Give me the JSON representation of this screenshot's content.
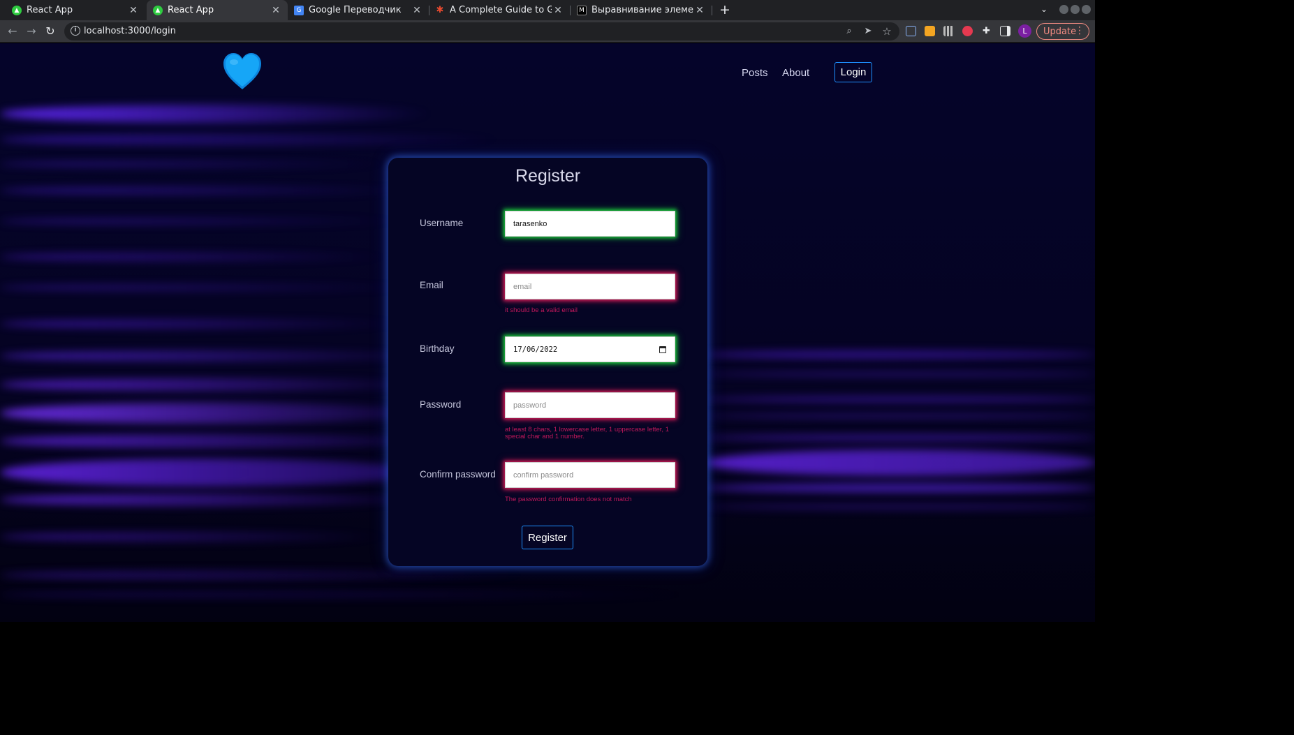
{
  "browser": {
    "tabs": [
      {
        "title": "React App",
        "favicon_color": "#2ecc40",
        "active": false
      },
      {
        "title": "React App",
        "favicon_color": "#2ecc40",
        "active": true
      },
      {
        "title": "Google Переводчик",
        "favicon_color": "#4285f4",
        "active": false
      },
      {
        "title": "A Complete Guide to Grid",
        "favicon_color": "#e84a2f",
        "active": false
      },
      {
        "title": "Выравнивание элементов",
        "favicon_color": "#000000",
        "active": false
      }
    ],
    "favicon_letters": {
      "google_translate": "G",
      "medium": "M"
    },
    "close_glyph": "✕",
    "new_tab": "+",
    "url": "localhost:3000/login",
    "update_label": "Update",
    "profile_initial": "L"
  },
  "header": {
    "logo": "blue-heart",
    "nav": {
      "posts": "Posts",
      "about": "About",
      "login": "Login"
    }
  },
  "form": {
    "title": "Register",
    "fields": {
      "username": {
        "label": "Username",
        "value": "tarasenko",
        "placeholder": "",
        "state": "valid"
      },
      "email": {
        "label": "Email",
        "value": "",
        "placeholder": "email",
        "state": "invalid",
        "error": "it should be a valid email"
      },
      "birthday": {
        "label": "Birthday",
        "value": "17/06/2022",
        "state": "valid"
      },
      "password": {
        "label": "Password",
        "value": "",
        "placeholder": "password",
        "state": "invalid",
        "error": "at least 8 chars, 1 lowercase letter, 1 uppercase letter, 1 special char and 1 number."
      },
      "confirm_password": {
        "label": "Confirm password",
        "value": "",
        "placeholder": "confirm password",
        "state": "invalid",
        "error": "The password confirmation does not match"
      }
    },
    "submit": "Register"
  },
  "colors": {
    "accent": "#1e90ff",
    "valid_glow": "#19c43a",
    "invalid_glow": "#d01a55",
    "error_text": "#c2185b",
    "background": "#05042a",
    "streak": "#5a1dff"
  }
}
